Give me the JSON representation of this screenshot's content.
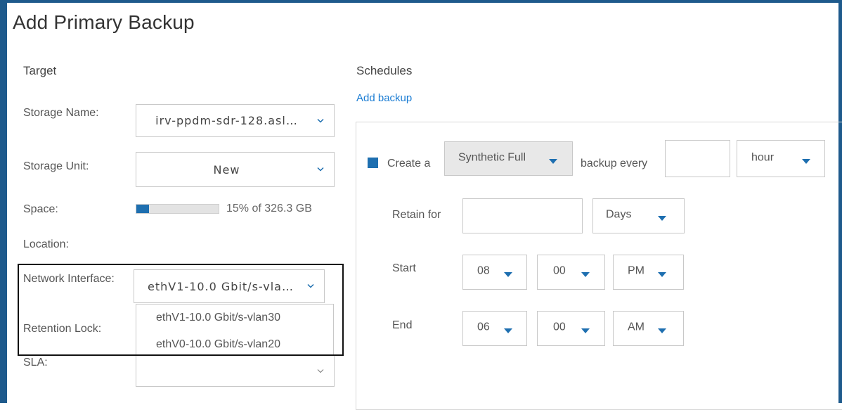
{
  "dialog": {
    "title": "Add Primary Backup"
  },
  "target": {
    "heading": "Target",
    "storage_name_label": "Storage Name:",
    "storage_name_value": "irv-ppdm-sdr-128.asl…",
    "storage_unit_label": "Storage Unit:",
    "storage_unit_value": "New",
    "space_label": "Space:",
    "space_fraction": 0.15,
    "space_text": "15% of 326.3 GB",
    "location_label": "Location:",
    "network_interface_label": "Network Interface:",
    "network_interface_value": "ethV1-10.0 Gbit/s-vla…",
    "network_options": [
      "ethV1-10.0 Gbit/s-vlan30",
      "ethV0-10.0 Gbit/s-vlan20"
    ],
    "retention_lock_label": "Retention Lock:",
    "sla_label": "SLA:",
    "sla_value": ""
  },
  "schedules": {
    "heading": "Schedules",
    "add_backup_link": "Add backup",
    "create_a": "Create a",
    "backup_type": "Synthetic Full",
    "backup_every": "backup every",
    "every_value": "",
    "every_unit": "hour",
    "retain_for_label": "Retain for",
    "retain_value": "",
    "retain_unit": "Days",
    "start_label": "Start",
    "start_hour": "08",
    "start_minute": "00",
    "start_ampm": "PM",
    "end_label": "End",
    "end_hour": "06",
    "end_minute": "00",
    "end_ampm": "AM"
  },
  "colors": {
    "accent": "#1e6fb0",
    "frame": "#1e5a8c",
    "link": "#1a7cd3"
  },
  "icons": {
    "select_chevron": "chevron-down-icon",
    "dropdown_caret": "caret-down-icon"
  }
}
